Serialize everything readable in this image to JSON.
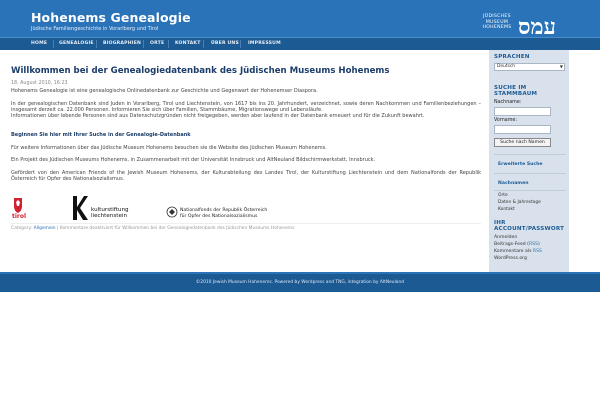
{
  "header": {
    "title": "Hohenems Genealogie",
    "subtitle": "Jüdische Familiengeschichte in Vorarlberg und Tirol",
    "museum_logo_lines": [
      "JÜDISCHES",
      "MUSEUM",
      "HOHENEMS"
    ],
    "hebrew_logo": "עמס"
  },
  "nav": [
    "HOME",
    "GENEALOGIE",
    "BIOGRAPHIEN",
    "ORTE",
    "KONTAKT",
    "ÜBER UNS",
    "IMPRESSUM"
  ],
  "post": {
    "title": "Willkommen bei der Genealogiedatenbank des Jüdischen Museums Hohenems",
    "date": "18. August 2010, 16:23",
    "p1": "Hohenems Genealogie ist eine genealogische Onlinedatenbank zur Geschichte und Gegenwart der Hohenemser Diaspora.",
    "p2": "In der genealogischen Datenbank sind Juden in Vorarlberg, Tirol und Liechtenstein, von 1617 bis ins 20. Jahrhundert, verzeichnet, sowie deren Nachkommen und Familienbeziehungen – insgesamt derzeit ca. 22.000 Personen. Informieren Sie sich über Familien, Stammbäume, Migrationswege und Lebensläufe.",
    "p2b": "Informationen über lebende Personen sind aus Datenschutzgründen nicht freigegeben, werden aber laufend in der Datenbank erneuert und für die Zukunft bewahrt.",
    "p3_link": "Beginnen Sie hier mit Ihrer Suche in der Genealogie-Datenbank",
    "p4": "Für weitere Informationen über das Jüdische Museum Hohenems besuchen sie die Website des Jüdischen Museum Hohenems.",
    "p5": "Ein Projekt des Jüdischen Museums Hohenems, in Zusammenarbeit mit der Universität Innsbruck und AltNeuland Bildschirmwerkstatt, Innsbruck.",
    "p6": "Gefördert von den American Friends of the Jewish Museum Hohenems, der Kulturabteilung des Landes Tirol, der Kulturstiftung Liechtenstein und dem Nationalfonds der Republik Österreich für Opfer des Nationalsozialismus.",
    "logo_tirol": "tirol",
    "logo_k_lines": [
      "kulturstiftung",
      "liechtenstein"
    ],
    "logo_nf_lines": [
      "Nationalfonds der Republik Österreich",
      "für Opfer des Nationalsozialismus"
    ],
    "meta_category_label": "Category:",
    "meta_category": "Allgemein",
    "meta_comments": "Kommentare deaktiviert für Willkommen bei der Genealogiedatenbank des Jüdischen Museums Hohenems"
  },
  "sidebar": {
    "lang_heading": "SPRACHEN",
    "lang_selected": "Deutsch",
    "search_heading_1": "SUCHE IM",
    "search_heading_2": "STAMMBAUM",
    "lastname_label": "Nachname:",
    "firstname_label": "Vorname:",
    "search_button": "Suche nach Namen",
    "advanced_search": "Erweiterte Suche",
    "names_heading": "Nachnamen",
    "sub_links": [
      "Orte",
      "Daten & Jahrestage",
      "Kontakt"
    ],
    "account_heading_1": "IHR",
    "account_heading_2": "ACCOUNT/PASSWORT",
    "login": "Anmelden",
    "feed1": "Beitrags-Feed (",
    "feed2": "Kommentare als ",
    "rss": "RSS",
    "wp": "WordPress.org"
  },
  "footer": {
    "text": "©2010 Jewish Museum Hohenems. Powered by Wordpress and TNG, integration by AltNeuland"
  },
  "colors": {
    "header_blue": "#2a73b8",
    "nav_blue": "#1c5a94",
    "sidebar_bg": "#d9e2ec",
    "tirol_red": "#d2202f"
  }
}
